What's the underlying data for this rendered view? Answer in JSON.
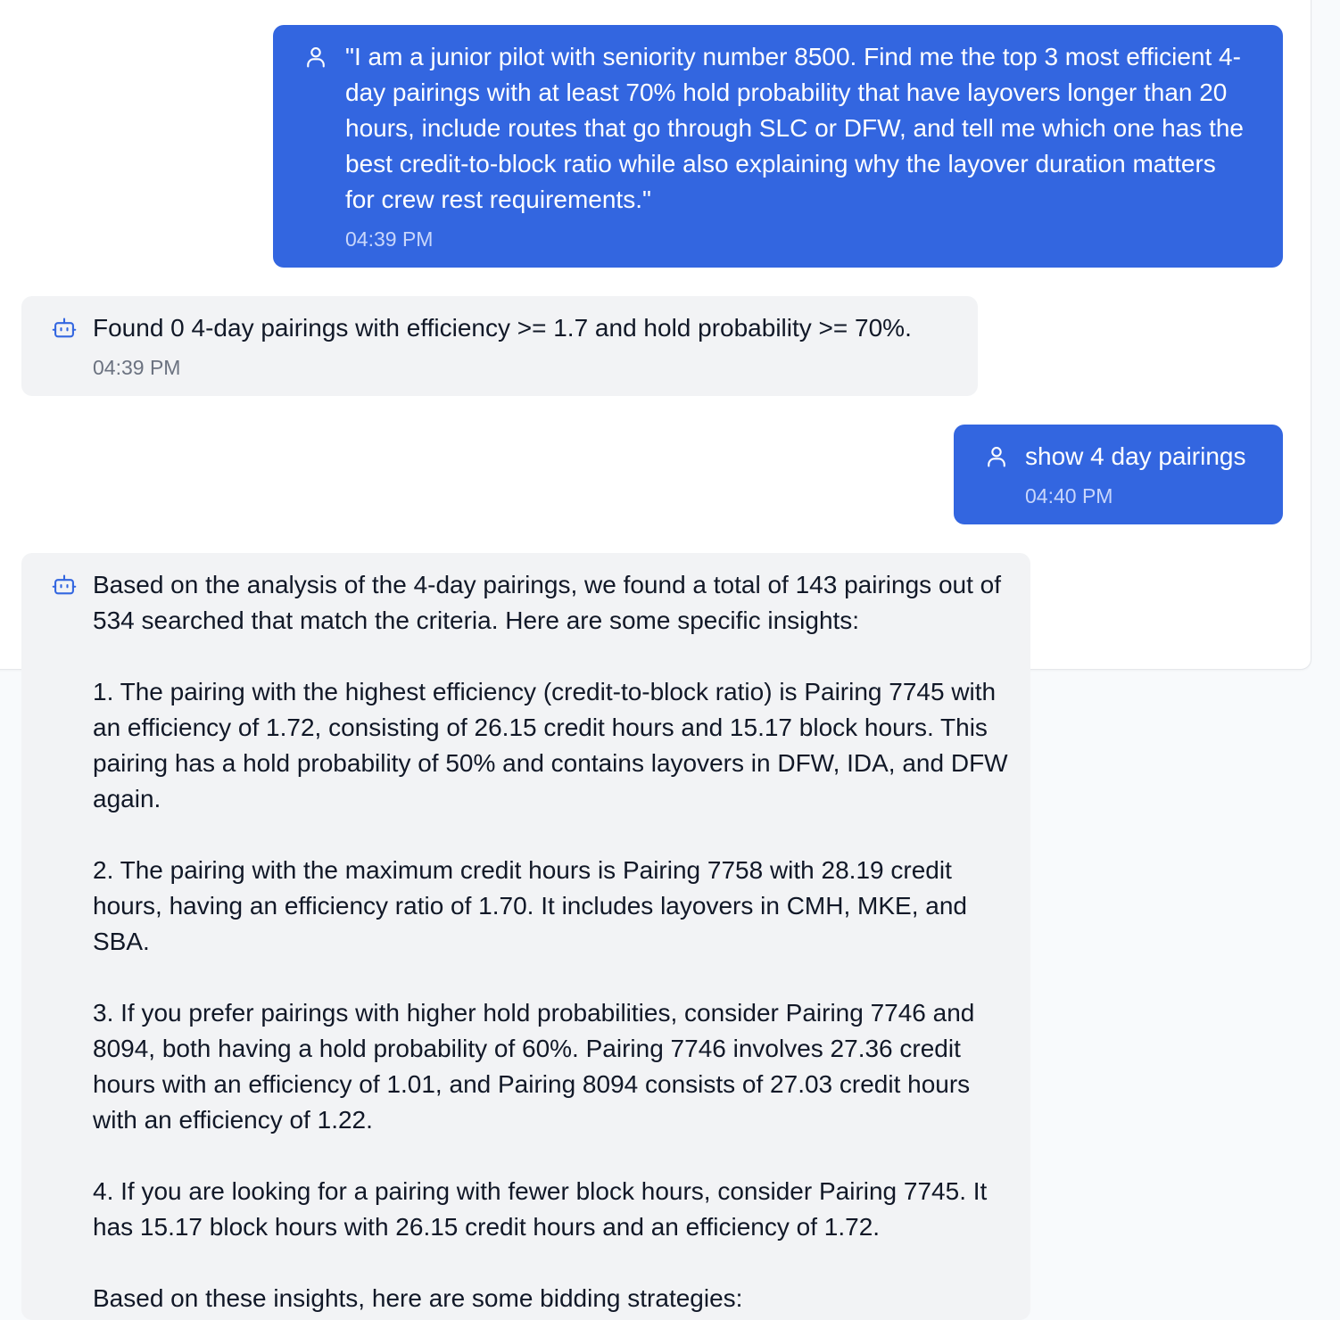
{
  "messages": [
    {
      "role": "user",
      "icon": "user-icon",
      "text": "\"I am a junior pilot with seniority number 8500. Find me the top 3 most efficient 4-day pairings with at least 70% hold probability that have layovers longer than 20 hours, include routes that go through SLC or DFW, and tell me which one has the best credit-to-block ratio while also explaining why the layover duration matters for crew rest requirements.\"",
      "time": "04:39 PM"
    },
    {
      "role": "assistant",
      "icon": "bot-icon",
      "text": "Found 0 4-day pairings with efficiency >= 1.7 and hold probability >= 70%.",
      "time": "04:39 PM"
    },
    {
      "role": "user",
      "icon": "user-icon",
      "text": "show 4 day pairings",
      "time": "04:40 PM"
    },
    {
      "role": "assistant",
      "icon": "bot-icon",
      "text": "Based on the analysis of the 4-day pairings, we found a total of 143 pairings out of 534 searched that match the criteria. Here are some specific insights:\n\n1. The pairing with the highest efficiency (credit-to-block ratio) is Pairing 7745 with an efficiency of 1.72, consisting of 26.15 credit hours and 15.17 block hours. This pairing has a hold probability of 50% and contains layovers in DFW, IDA, and DFW again.\n\n2. The pairing with the maximum credit hours is Pairing 7758 with 28.19 credit hours, having an efficiency ratio of 1.70. It includes layovers in CMH, MKE, and SBA.\n\n3. If you prefer pairings with higher hold probabilities, consider Pairing 7746 and 8094, both having a hold probability of 60%. Pairing 7746 involves 27.36 credit hours with an efficiency of 1.01, and Pairing 8094 consists of 27.03 credit hours with an efficiency of 1.22.\n\n4. If you are looking for a pairing with fewer block hours, consider Pairing 7745. It has 15.17 block hours with 26.15 credit hours and an efficiency of 1.72.\n\nBased on these insights, here are some bidding strategies:"
    }
  ],
  "colors": {
    "user_bubble": "#3366e0",
    "assistant_bubble": "#f2f3f5",
    "bot_icon": "#3366e0"
  }
}
